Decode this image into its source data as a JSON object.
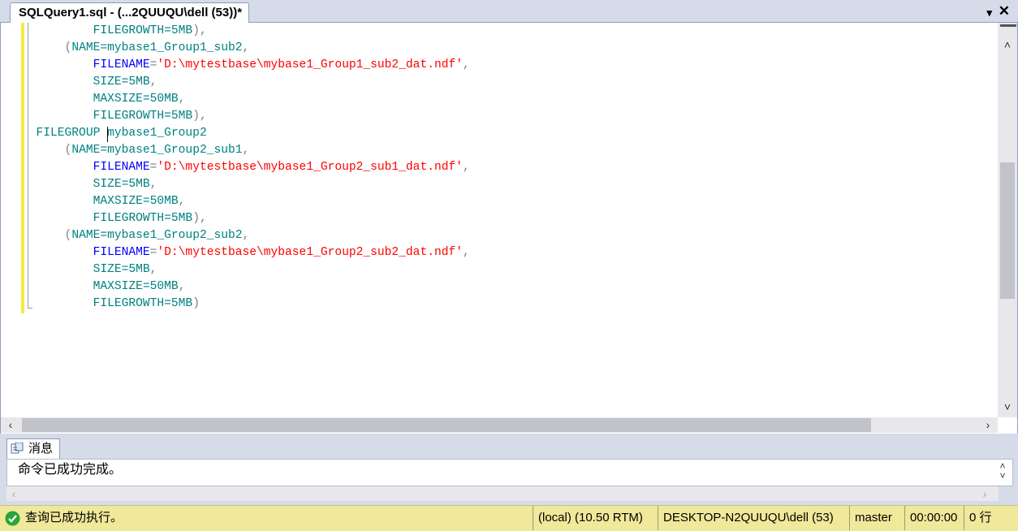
{
  "tab": {
    "title": "SQLQuery1.sql - (...2QUUQU\\dell (53))*",
    "dropdown": "▾",
    "close": "✕"
  },
  "editor": {
    "lines": [
      [
        {
          "c": "plain",
          "t": "          FILEGROWTH=5MB"
        },
        {
          "c": "gr",
          "t": "),"
        }
      ],
      [
        {
          "c": "gr",
          "t": "      ("
        },
        {
          "c": "plain",
          "t": "NAME=mybase1_Group1_sub2"
        },
        {
          "c": "gr",
          "t": ","
        }
      ],
      [
        {
          "c": "kw",
          "t": "          FILENAME"
        },
        {
          "c": "gr",
          "t": "="
        },
        {
          "c": "str",
          "t": "'D:\\mytestbase\\mybase1_Group1_sub2_dat.ndf'"
        },
        {
          "c": "gr",
          "t": ","
        }
      ],
      [
        {
          "c": "plain",
          "t": "          SIZE=5MB"
        },
        {
          "c": "gr",
          "t": ","
        }
      ],
      [
        {
          "c": "plain",
          "t": "          MAXSIZE=50MB"
        },
        {
          "c": "gr",
          "t": ","
        }
      ],
      [
        {
          "c": "plain",
          "t": "          FILEGROWTH=5MB"
        },
        {
          "c": "gr",
          "t": "),"
        }
      ],
      [
        {
          "c": "plain",
          "t": "  FILEGROUP mybase1_Group2"
        }
      ],
      [
        {
          "c": "gr",
          "t": "      ("
        },
        {
          "c": "plain",
          "t": "NAME=mybase1_Group2_sub1"
        },
        {
          "c": "gr",
          "t": ","
        }
      ],
      [
        {
          "c": "kw",
          "t": "          FILENAME"
        },
        {
          "c": "gr",
          "t": "="
        },
        {
          "c": "str",
          "t": "'D:\\mytestbase\\mybase1_Group2_sub1_dat.ndf'"
        },
        {
          "c": "gr",
          "t": ","
        }
      ],
      [
        {
          "c": "plain",
          "t": "          SIZE=5MB"
        },
        {
          "c": "gr",
          "t": ","
        }
      ],
      [
        {
          "c": "plain",
          "t": "          MAXSIZE=50MB"
        },
        {
          "c": "gr",
          "t": ","
        }
      ],
      [
        {
          "c": "plain",
          "t": "          FILEGROWTH=5MB"
        },
        {
          "c": "gr",
          "t": "),"
        }
      ],
      [
        {
          "c": "gr",
          "t": "      ("
        },
        {
          "c": "plain",
          "t": "NAME=mybase1_Group2_sub2"
        },
        {
          "c": "gr",
          "t": ","
        }
      ],
      [
        {
          "c": "kw",
          "t": "          FILENAME"
        },
        {
          "c": "gr",
          "t": "="
        },
        {
          "c": "str",
          "t": "'D:\\mytestbase\\mybase1_Group2_sub2_dat.ndf'"
        },
        {
          "c": "gr",
          "t": ","
        }
      ],
      [
        {
          "c": "plain",
          "t": "          SIZE=5MB"
        },
        {
          "c": "gr",
          "t": ","
        }
      ],
      [
        {
          "c": "plain",
          "t": "          MAXSIZE=50MB"
        },
        {
          "c": "gr",
          "t": ","
        }
      ],
      [
        {
          "c": "plain",
          "t": "          FILEGROWTH=5MB"
        },
        {
          "c": "gr",
          "t": ")"
        }
      ]
    ],
    "colors": {
      "keyword": "#0000ff",
      "operator": "#808080",
      "string": "#ff0000",
      "identifier": "#008080",
      "change_marker": "#f4ea3c"
    }
  },
  "messages": {
    "tab_label": "消息",
    "text": "命令已成功完成。"
  },
  "status": {
    "main": "查询已成功执行。",
    "server": "(local) (10.50 RTM)",
    "user": "DESKTOP-N2QUUQU\\dell (53)",
    "database": "master",
    "elapsed": "00:00:00",
    "rows": "0 行",
    "color": "#f0e89a",
    "icon": "success-check-icon"
  }
}
